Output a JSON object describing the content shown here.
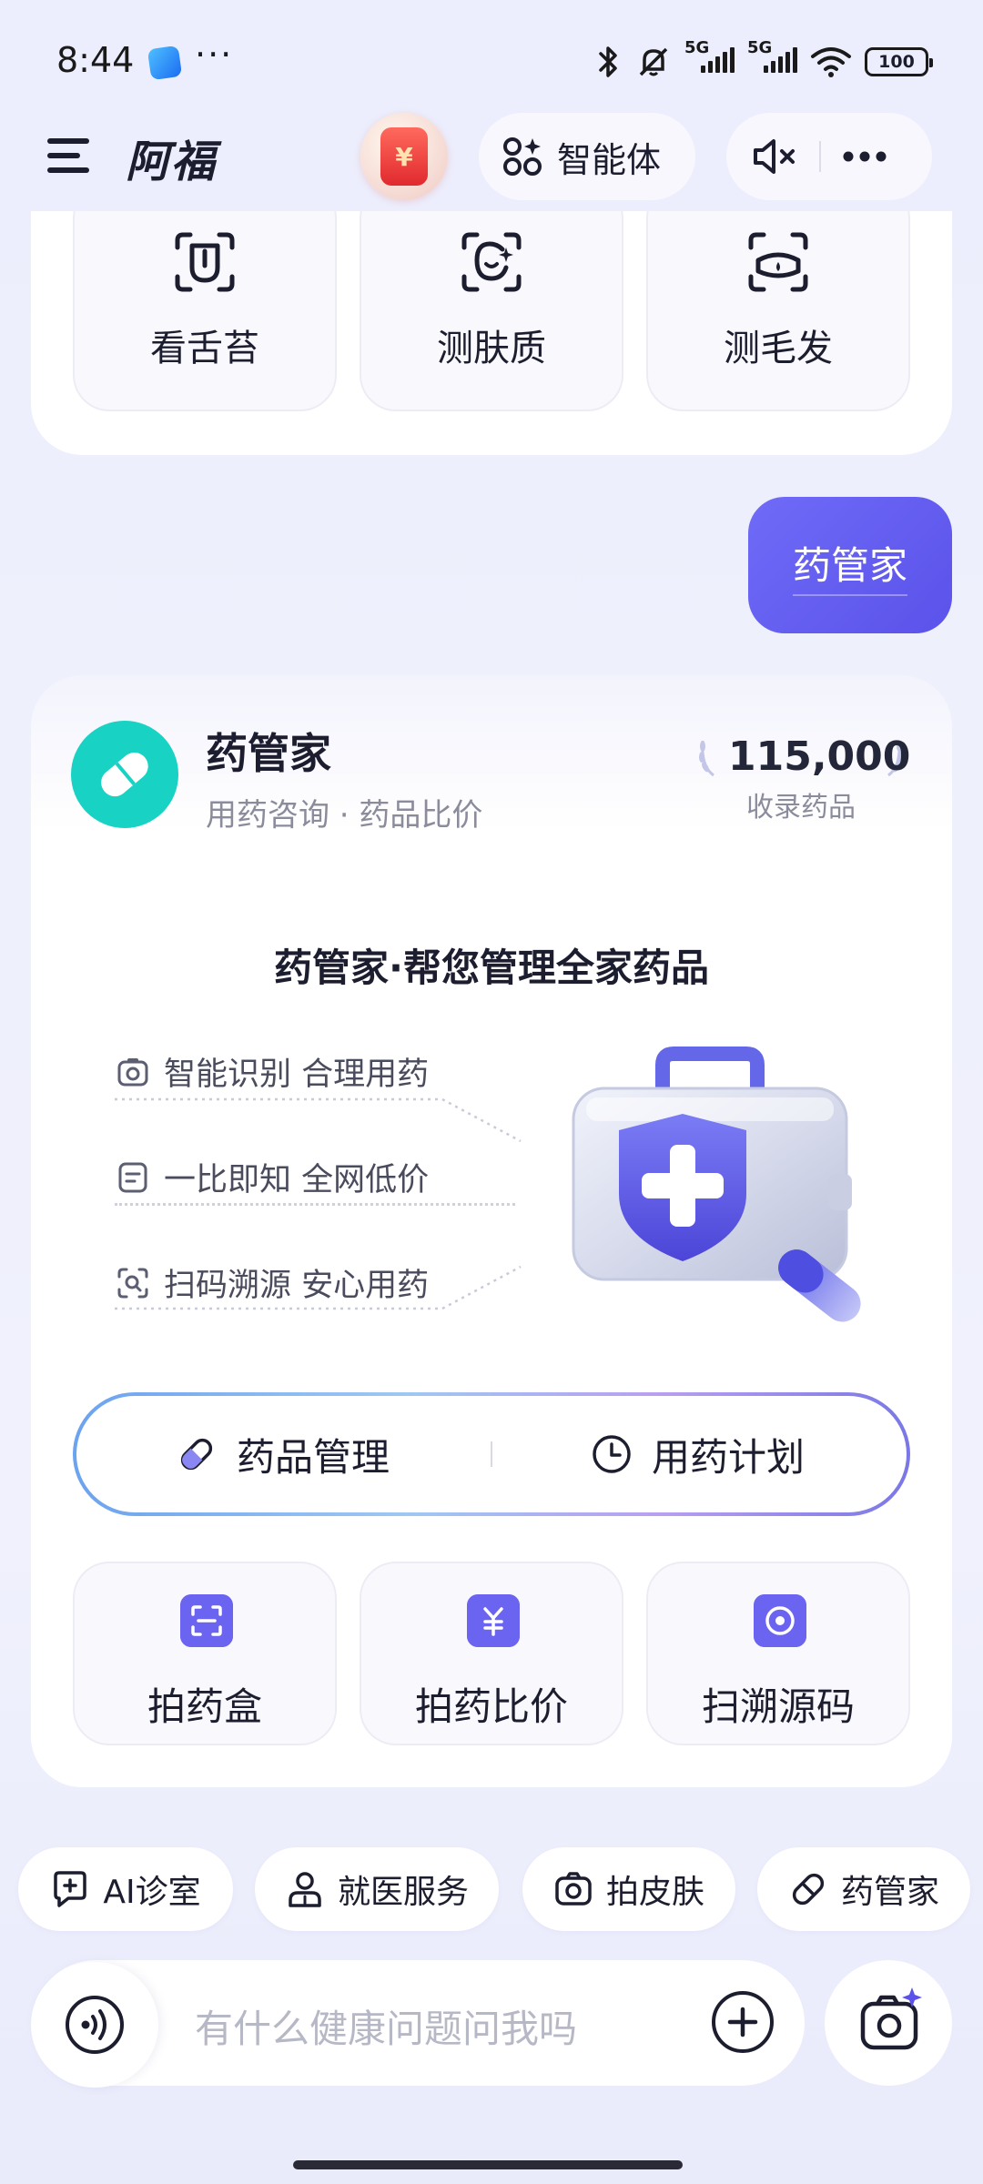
{
  "status_bar": {
    "time": "8:44",
    "more": "···",
    "signal1": "5G",
    "signal2": "5G",
    "battery": "100"
  },
  "header": {
    "brand": "阿福",
    "coin_symbol": "¥",
    "agent_label": "智能体"
  },
  "top_tools": [
    {
      "label": "看舌苔",
      "icon": "tongue-scan-icon"
    },
    {
      "label": "测肤质",
      "icon": "face-scan-icon"
    },
    {
      "label": "测毛发",
      "icon": "hair-scan-icon"
    }
  ],
  "user_message": "药管家",
  "card": {
    "title": "药管家",
    "subtitle": "用药咨询 · 药品比价",
    "stat_value": "115,000",
    "stat_label": "收录药品",
    "inner_title": "药管家·帮您管理全家药品",
    "features": [
      {
        "label": "智能识别 合理用药",
        "icon": "camera-icon"
      },
      {
        "label": "一比即知 全网低价",
        "icon": "document-icon"
      },
      {
        "label": "扫码溯源 安心用药",
        "icon": "scan-icon"
      }
    ],
    "buttons": {
      "left": "药品管理",
      "right": "用药计划"
    },
    "actions": [
      {
        "label": "拍药盒",
        "icon": "scan-frame-icon"
      },
      {
        "label": "拍药比价",
        "icon": "yuan-icon"
      },
      {
        "label": "扫溯源码",
        "icon": "target-icon"
      }
    ]
  },
  "chips": [
    {
      "label": "AI诊室",
      "icon": "chat-plus-icon"
    },
    {
      "label": "就医服务",
      "icon": "doctor-icon"
    },
    {
      "label": "拍皮肤",
      "icon": "camera-icon"
    },
    {
      "label": "药管家",
      "icon": "pill-icon"
    }
  ],
  "input": {
    "placeholder": "有什么健康问题问我吗"
  },
  "colors": {
    "accent": "#5b52ea",
    "teal": "#18d2c3",
    "background": "#eceefd"
  }
}
